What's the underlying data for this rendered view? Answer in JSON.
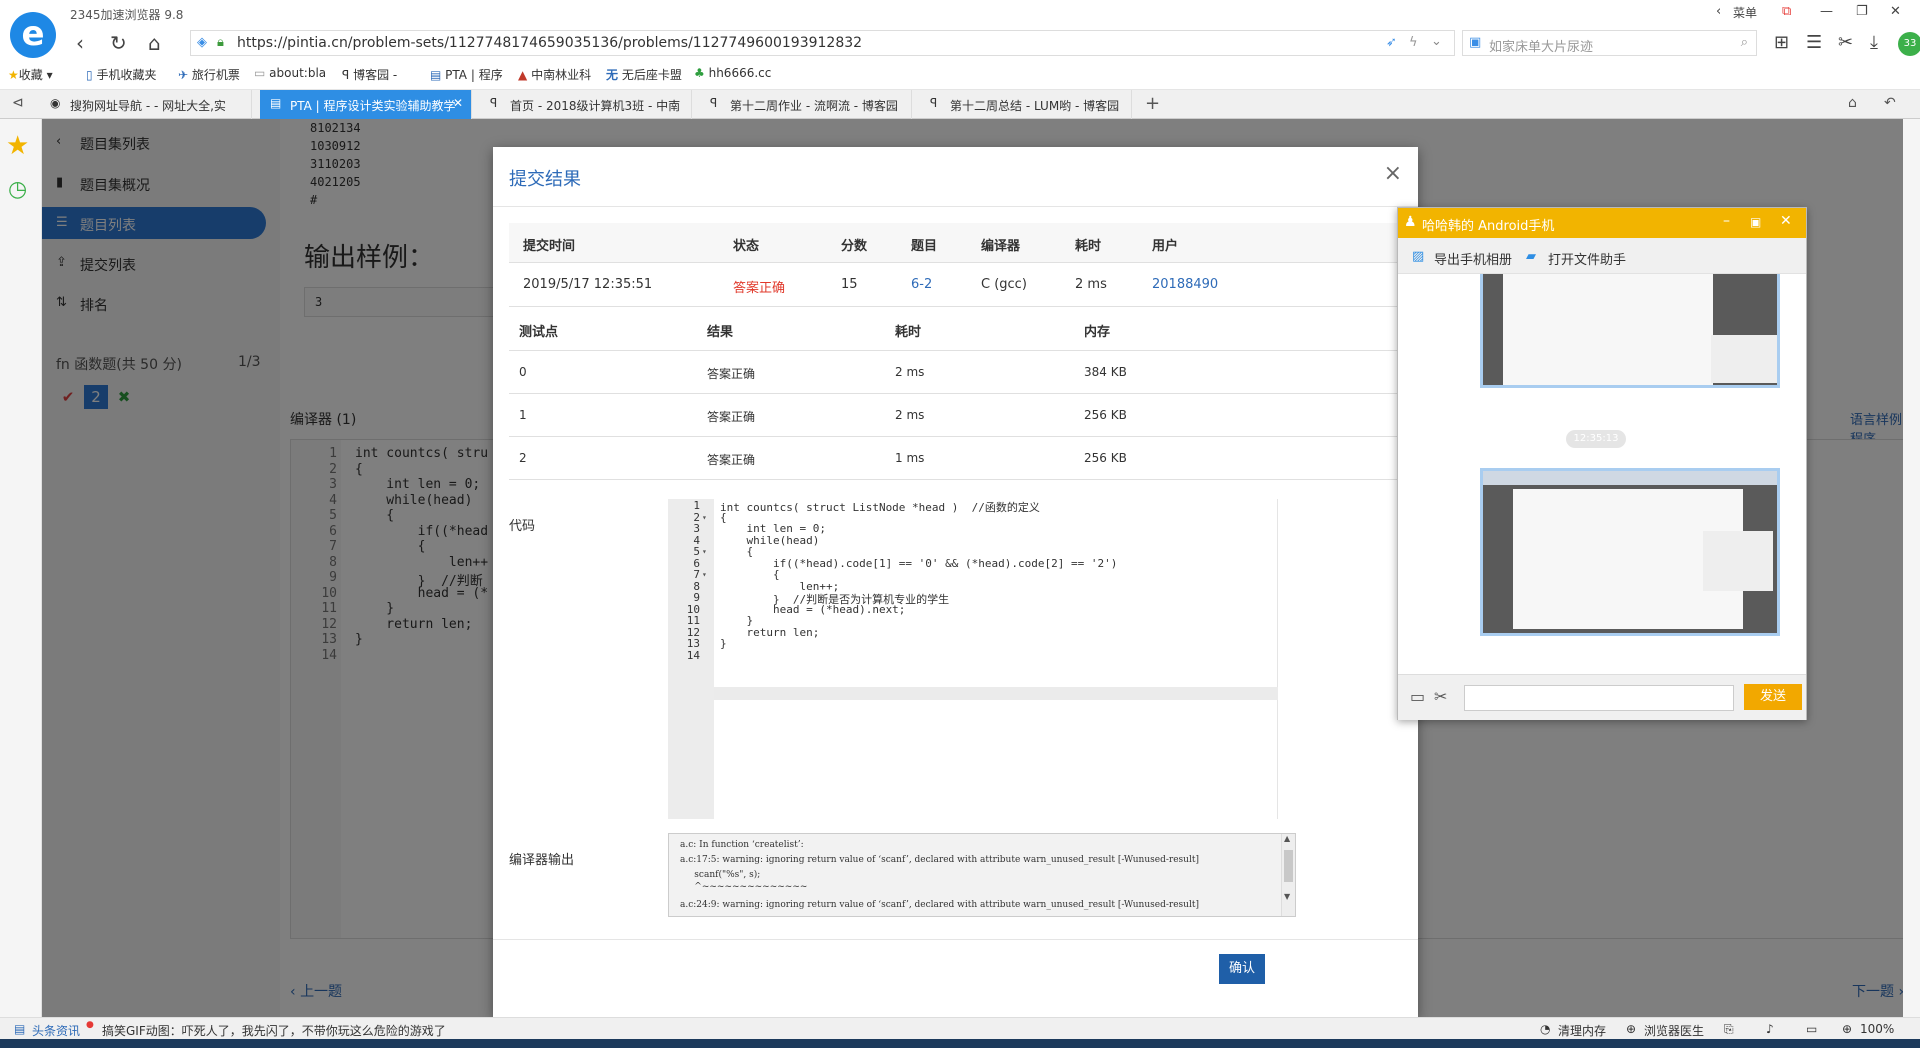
{
  "browser": {
    "name": "2345加速浏览器 9.8",
    "logo": "e",
    "menu_label": "菜单",
    "url": "https://pintia.cn/problem-sets/1127748174659035136/problems/1127749600193912832",
    "search_placeholder": "如家床单大片尿迹",
    "badge": "33"
  },
  "bookmarks": [
    {
      "label": "收藏",
      "icon": "star-icon"
    },
    {
      "label": "手机收藏夹",
      "icon": "phone-icon"
    },
    {
      "label": "旅行机票",
      "icon": "plane-icon"
    },
    {
      "label": "about:bla",
      "icon": "page-icon"
    },
    {
      "label": "博客园 -",
      "icon": "blog-icon"
    },
    {
      "label": "PTA | 程序",
      "icon": "pta-icon"
    },
    {
      "label": "中南林业科",
      "icon": "school-icon"
    },
    {
      "label": "无后座卡盟",
      "icon": "card-icon"
    },
    {
      "label": "hh6666.cc",
      "icon": "tree-icon"
    }
  ],
  "tabs": [
    {
      "label": "搜狗网址导航 - - 网址大全,实",
      "active": false
    },
    {
      "label": "PTA | 程序设计类实验辅助教学",
      "active": true
    },
    {
      "label": "首页 - 2018级计算机3班 - 中南",
      "active": false
    },
    {
      "label": "第十二周作业 - 流啊流 - 博客园",
      "active": false
    },
    {
      "label": "第十二周总结 - LUM哟 - 博客园",
      "active": false
    }
  ],
  "sidebar": {
    "items": [
      {
        "label": "题目集列表",
        "icon": "chevron-left-icon"
      },
      {
        "label": "题目集概况",
        "icon": "book-icon"
      },
      {
        "label": "题目列表",
        "icon": "list-icon"
      },
      {
        "label": "提交列表",
        "icon": "upload-icon"
      },
      {
        "label": "排名",
        "icon": "sort-icon"
      }
    ],
    "section": "函数题(共 50 分)",
    "section_prefix": "fn",
    "progress": "1/3",
    "question_number": "2"
  },
  "page": {
    "sample_lines": [
      "8102134",
      "1030912",
      "3110203",
      "4021205",
      "#"
    ],
    "output_heading": "输出样例：",
    "output_value": "3",
    "editor_label": "编译器 (1)",
    "sample_link": "语言样例程序",
    "prev": "上一题",
    "next": "下一题",
    "editor_lines": [
      {
        "n": "1",
        "code": "int countcs( stru"
      },
      {
        "n": "2",
        "code": "{"
      },
      {
        "n": "3",
        "code": "    int len = 0;"
      },
      {
        "n": "4",
        "code": "    while(head)"
      },
      {
        "n": "5",
        "code": "    {"
      },
      {
        "n": "6",
        "code": "        if((*head"
      },
      {
        "n": "7",
        "code": "        {"
      },
      {
        "n": "8",
        "code": "            len++"
      },
      {
        "n": "9",
        "code": "        }  //判断"
      },
      {
        "n": "10",
        "code": "        head = (*"
      },
      {
        "n": "11",
        "code": "    }"
      },
      {
        "n": "12",
        "code": "    return len;"
      },
      {
        "n": "13",
        "code": "}"
      },
      {
        "n": "14",
        "code": ""
      }
    ]
  },
  "modal": {
    "title": "提交结果",
    "summary_headers": [
      "提交时间",
      "状态",
      "分数",
      "题目",
      "编译器",
      "耗时",
      "用户"
    ],
    "summary": {
      "time": "2019/5/17 12:35:51",
      "status": "答案正确",
      "score": "15",
      "problem": "6-2",
      "compiler": "C (gcc)",
      "elapsed": "2 ms",
      "user": "20188490"
    },
    "testcase_headers": [
      "测试点",
      "结果",
      "耗时",
      "内存"
    ],
    "testcases": [
      {
        "id": "0",
        "result": "答案正确",
        "time": "2 ms",
        "memory": "384 KB"
      },
      {
        "id": "1",
        "result": "答案正确",
        "time": "2 ms",
        "memory": "256 KB"
      },
      {
        "id": "2",
        "result": "答案正确",
        "time": "1 ms",
        "memory": "256 KB"
      }
    ],
    "code_label": "代码",
    "code_lines": [
      "int countcs( struct ListNode *head )  //函数的定义",
      "{",
      "    int len = 0;",
      "    while(head)",
      "    {",
      "        if((*head).code[1] == '0' && (*head).code[2] == '2')",
      "        {",
      "            len++;",
      "        }  //判断是否为计算机专业的学生",
      "        head = (*head).next;",
      "    }",
      "    return len;",
      "}",
      ""
    ],
    "compiler_label": "编译器输出",
    "compiler_output": [
      "a.c: In function ‘createlist’:",
      "a.c:17:5: warning: ignoring return value of ‘scanf’, declared with attribute warn_unused_result [-Wunused-result]",
      "     scanf(\"%s\", s);",
      "     ^~~~~~~~~~~~~~~",
      "a.c:24:9: warning: ignoring return value of ‘scanf’, declared with attribute warn_unused_result [-Wunused-result]"
    ],
    "confirm_label": "确认"
  },
  "qq": {
    "title": "哈哈韩的 Android手机",
    "export_label": "导出手机相册",
    "open_label": "打开文件助手",
    "timestamp": "12:35:13",
    "send_label": "发送"
  },
  "statusbar": {
    "news_label": "头条资讯",
    "news_text": "搞笑GIF动图：吓死人了，我先闪了，不带你玩这么危险的游戏了",
    "clean_label": "清理内存",
    "doctor_label": "浏览器医生",
    "zoom": "100%"
  },
  "colors": {
    "accent": "#2e7bd6",
    "tab_active": "#2e8ee4",
    "accepted": "#e0392b",
    "qq_yellow": "#f2b400",
    "confirm": "#1f5fa8"
  }
}
